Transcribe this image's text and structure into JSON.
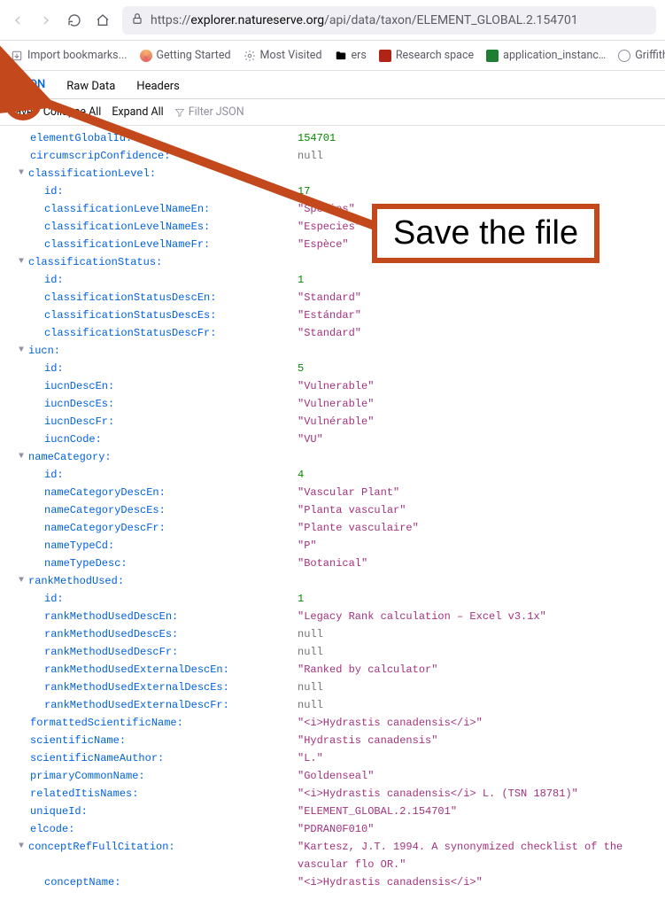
{
  "url": {
    "scheme": "https://",
    "host": "explorer.natureserve.org",
    "path": "/api/data/taxon/ELEMENT_GLOBAL.2.154701"
  },
  "bookmarks": {
    "import": "Import bookmarks...",
    "getting_started": "Getting Started",
    "most_visited": "Most Visited",
    "ers": "ers",
    "research_space": "Research space",
    "application_instanc": "application_instanc…",
    "griffith": "Griffith Uni"
  },
  "tabs": {
    "json": "JSON",
    "raw": "Raw Data",
    "headers": "Headers"
  },
  "actions": {
    "save": "Save",
    "collapse": "Collapse All",
    "expand": "Expand All",
    "filter_placeholder": "Filter JSON"
  },
  "annotation": {
    "label": "Save the file"
  },
  "json": {
    "elementGlobalId": {
      "k": "elementGlobalId:",
      "v": "154701",
      "t": "num"
    },
    "circumscripConfidence": {
      "k": "circumscripConfidence:",
      "v": "null",
      "t": "nul"
    },
    "classificationLevel": {
      "k": "classificationLevel:",
      "children": {
        "id": {
          "k": "id:",
          "v": "17",
          "t": "num"
        },
        "nameEn": {
          "k": "classificationLevelNameEn:",
          "v": "\"Species\"",
          "t": "str"
        },
        "nameEs": {
          "k": "classificationLevelNameEs:",
          "v": "\"Especies\"",
          "t": "str"
        },
        "nameFr": {
          "k": "classificationLevelNameFr:",
          "v": "\"Espèce\"",
          "t": "str"
        }
      }
    },
    "classificationStatus": {
      "k": "classificationStatus:",
      "children": {
        "id": {
          "k": "id:",
          "v": "1",
          "t": "num"
        },
        "descEn": {
          "k": "classificationStatusDescEn:",
          "v": "\"Standard\"",
          "t": "str"
        },
        "descEs": {
          "k": "classificationStatusDescEs:",
          "v": "\"Estándar\"",
          "t": "str"
        },
        "descFr": {
          "k": "classificationStatusDescFr:",
          "v": "\"Standard\"",
          "t": "str"
        }
      }
    },
    "iucn": {
      "k": "iucn:",
      "children": {
        "id": {
          "k": "id:",
          "v": "5",
          "t": "num"
        },
        "descEn": {
          "k": "iucnDescEn:",
          "v": "\"Vulnerable\"",
          "t": "str"
        },
        "descEs": {
          "k": "iucnDescEs:",
          "v": "\"Vulnerable\"",
          "t": "str"
        },
        "descFr": {
          "k": "iucnDescFr:",
          "v": "\"Vulnérable\"",
          "t": "str"
        },
        "code": {
          "k": "iucnCode:",
          "v": "\"VU\"",
          "t": "str"
        }
      }
    },
    "nameCategory": {
      "k": "nameCategory:",
      "children": {
        "id": {
          "k": "id:",
          "v": "4",
          "t": "num"
        },
        "descEn": {
          "k": "nameCategoryDescEn:",
          "v": "\"Vascular Plant\"",
          "t": "str"
        },
        "descEs": {
          "k": "nameCategoryDescEs:",
          "v": "\"Planta vascular\"",
          "t": "str"
        },
        "descFr": {
          "k": "nameCategoryDescFr:",
          "v": "\"Plante vasculaire\"",
          "t": "str"
        },
        "typeCd": {
          "k": "nameTypeCd:",
          "v": "\"P\"",
          "t": "str"
        },
        "typeDesc": {
          "k": "nameTypeDesc:",
          "v": "\"Botanical\"",
          "t": "str"
        }
      }
    },
    "rankMethodUsed": {
      "k": "rankMethodUsed:",
      "children": {
        "id": {
          "k": "id:",
          "v": "1",
          "t": "num"
        },
        "descEn": {
          "k": "rankMethodUsedDescEn:",
          "v": "\"Legacy Rank calculation – Excel v3.1x\"",
          "t": "str"
        },
        "descEs": {
          "k": "rankMethodUsedDescEs:",
          "v": "null",
          "t": "nul"
        },
        "descFr": {
          "k": "rankMethodUsedDescFr:",
          "v": "null",
          "t": "nul"
        },
        "extEn": {
          "k": "rankMethodUsedExternalDescEn:",
          "v": "\"Ranked by calculator\"",
          "t": "str"
        },
        "extEs": {
          "k": "rankMethodUsedExternalDescEs:",
          "v": "null",
          "t": "nul"
        },
        "extFr": {
          "k": "rankMethodUsedExternalDescFr:",
          "v": "null",
          "t": "nul"
        }
      }
    },
    "formattedScientificName": {
      "k": "formattedScientificName:",
      "v": "\"<i>Hydrastis canadensis</i>\"",
      "t": "str"
    },
    "scientificName": {
      "k": "scientificName:",
      "v": "\"Hydrastis canadensis\"",
      "t": "str"
    },
    "scientificNameAuthor": {
      "k": "scientificNameAuthor:",
      "v": "\"L.\"",
      "t": "str"
    },
    "primaryCommonName": {
      "k": "primaryCommonName:",
      "v": "\"Goldenseal\"",
      "t": "str"
    },
    "relatedItisNames": {
      "k": "relatedItisNames:",
      "v": "\"<i>Hydrastis canadensis</i> L. (TSN 18781)\"",
      "t": "str"
    },
    "uniqueId": {
      "k": "uniqueId:",
      "v": "\"ELEMENT_GLOBAL.2.154701\"",
      "t": "str"
    },
    "elcode": {
      "k": "elcode:",
      "v": "\"PDRAN0F010\"",
      "t": "str"
    },
    "conceptRefFullCitation": {
      "k": "conceptRefFullCitation:",
      "v": "\"Kartesz, J.T. 1994. A synonymized checklist of the vascular flo OR.\"",
      "t": "str",
      "children": {
        "conceptName": {
          "k": "conceptName:",
          "v": "\"<i>Hydrastis canadensis</i>\"",
          "t": "str"
        }
      }
    }
  }
}
